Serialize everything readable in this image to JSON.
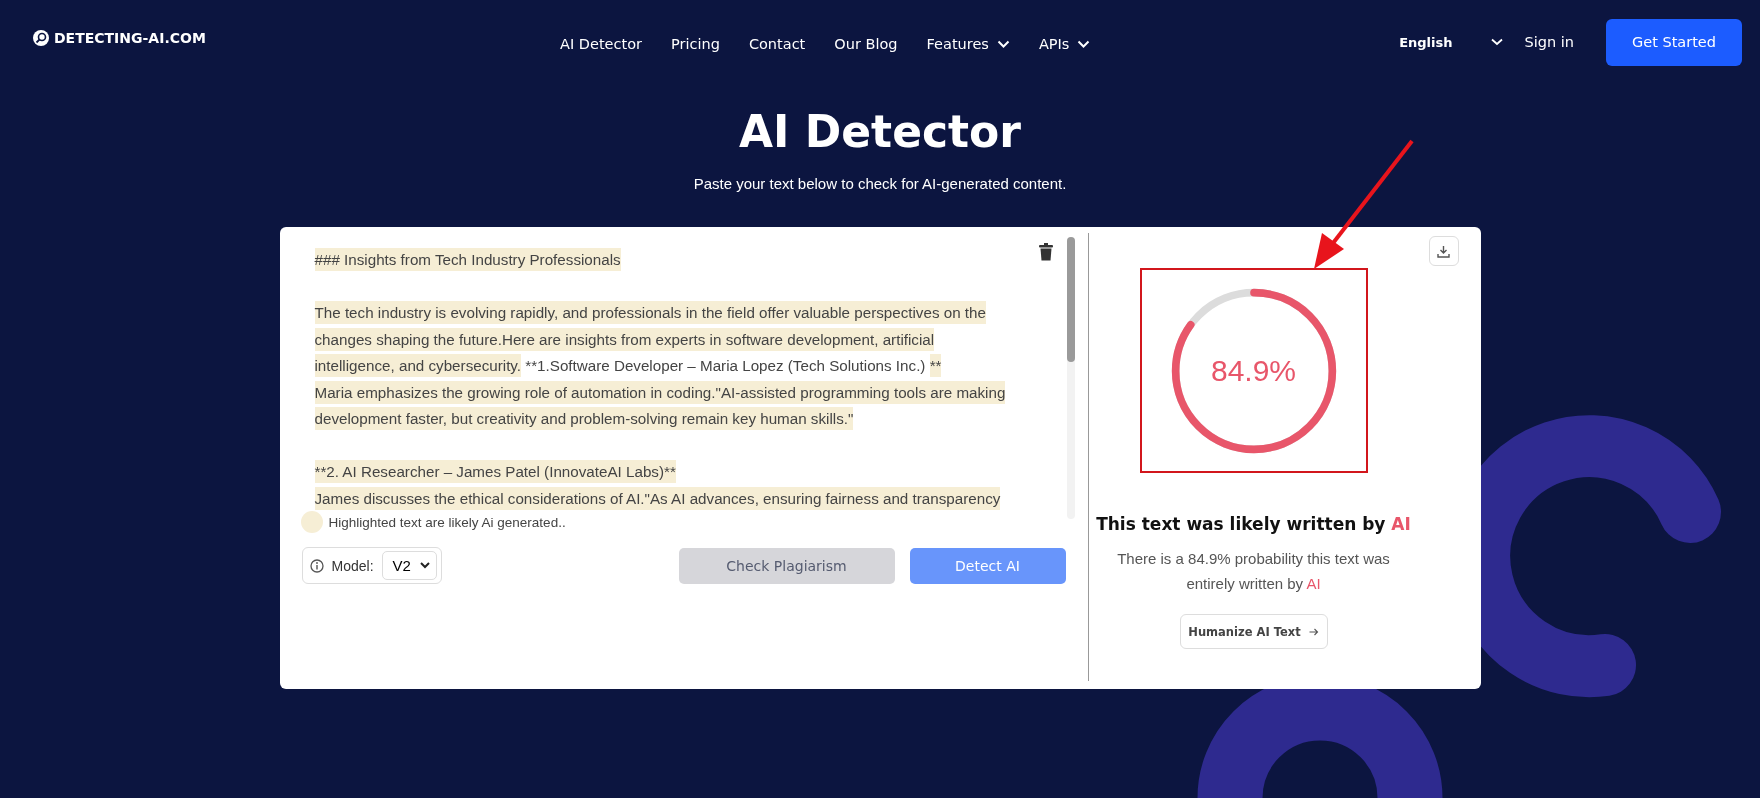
{
  "header": {
    "logo": "DETECTING-AI.COM",
    "nav": [
      {
        "label": "AI Detector",
        "has_menu": false
      },
      {
        "label": "Pricing",
        "has_menu": false
      },
      {
        "label": "Contact",
        "has_menu": false
      },
      {
        "label": "Our Blog",
        "has_menu": false
      },
      {
        "label": "Features",
        "has_menu": true
      },
      {
        "label": "APIs",
        "has_menu": true
      }
    ],
    "language": "English",
    "sign_in": "Sign in",
    "cta": "Get Started"
  },
  "hero": {
    "title": "AI Detector",
    "subtitle": "Paste your text below to check for AI-generated content."
  },
  "editor": {
    "paragraphs": [
      [
        [
          {
            "text": "### Insights from Tech Industry Professionals",
            "highlighted": true
          }
        ]
      ],
      [
        [
          {
            "text": "The tech industry is evolving rapidly, and professionals in the field offer valuable perspectives on the",
            "highlighted": true
          }
        ],
        [
          {
            "text": "changes shaping the future.Here are insights from experts in software development, artificial",
            "highlighted": true
          }
        ],
        [
          {
            "text": "intelligence, and cybersecurity.",
            "highlighted": true
          },
          {
            "text": " **1.Software Developer – Maria Lopez (Tech Solutions Inc.) ",
            "highlighted": false
          },
          {
            "text": "**",
            "highlighted": true
          }
        ],
        [
          {
            "text": "Maria emphasizes the growing role of automation in coding.\"AI-assisted programming tools are making",
            "highlighted": true
          }
        ],
        [
          {
            "text": "development faster, but creativity and problem-solving remain key human skills.\"",
            "highlighted": true
          }
        ]
      ],
      [
        [
          {
            "text": "**2. AI Researcher – James Patel (InnovateAI Labs)**",
            "highlighted": true
          }
        ],
        [
          {
            "text": "James discusses the ethical considerations of AI.\"As AI advances, ensuring fairness and transparency",
            "highlighted": true
          }
        ]
      ]
    ],
    "legend": "Highlighted text are likely Ai generated..",
    "model_label": "Model:",
    "model": "V2",
    "buttons": [
      {
        "label": "Check Plagiarism",
        "kind": "secondary"
      },
      {
        "label": "Detect AI",
        "kind": "primary"
      }
    ]
  },
  "result": {
    "score": "84.9%",
    "level": 0.849,
    "heading": {
      "text": "This text was likely written by",
      "emphasis": "AI"
    },
    "description": {
      "text": "There is a 84.9% probability this text was entirely written by",
      "emphasis": "AI"
    },
    "humanize": "Humanize AI Text"
  }
}
